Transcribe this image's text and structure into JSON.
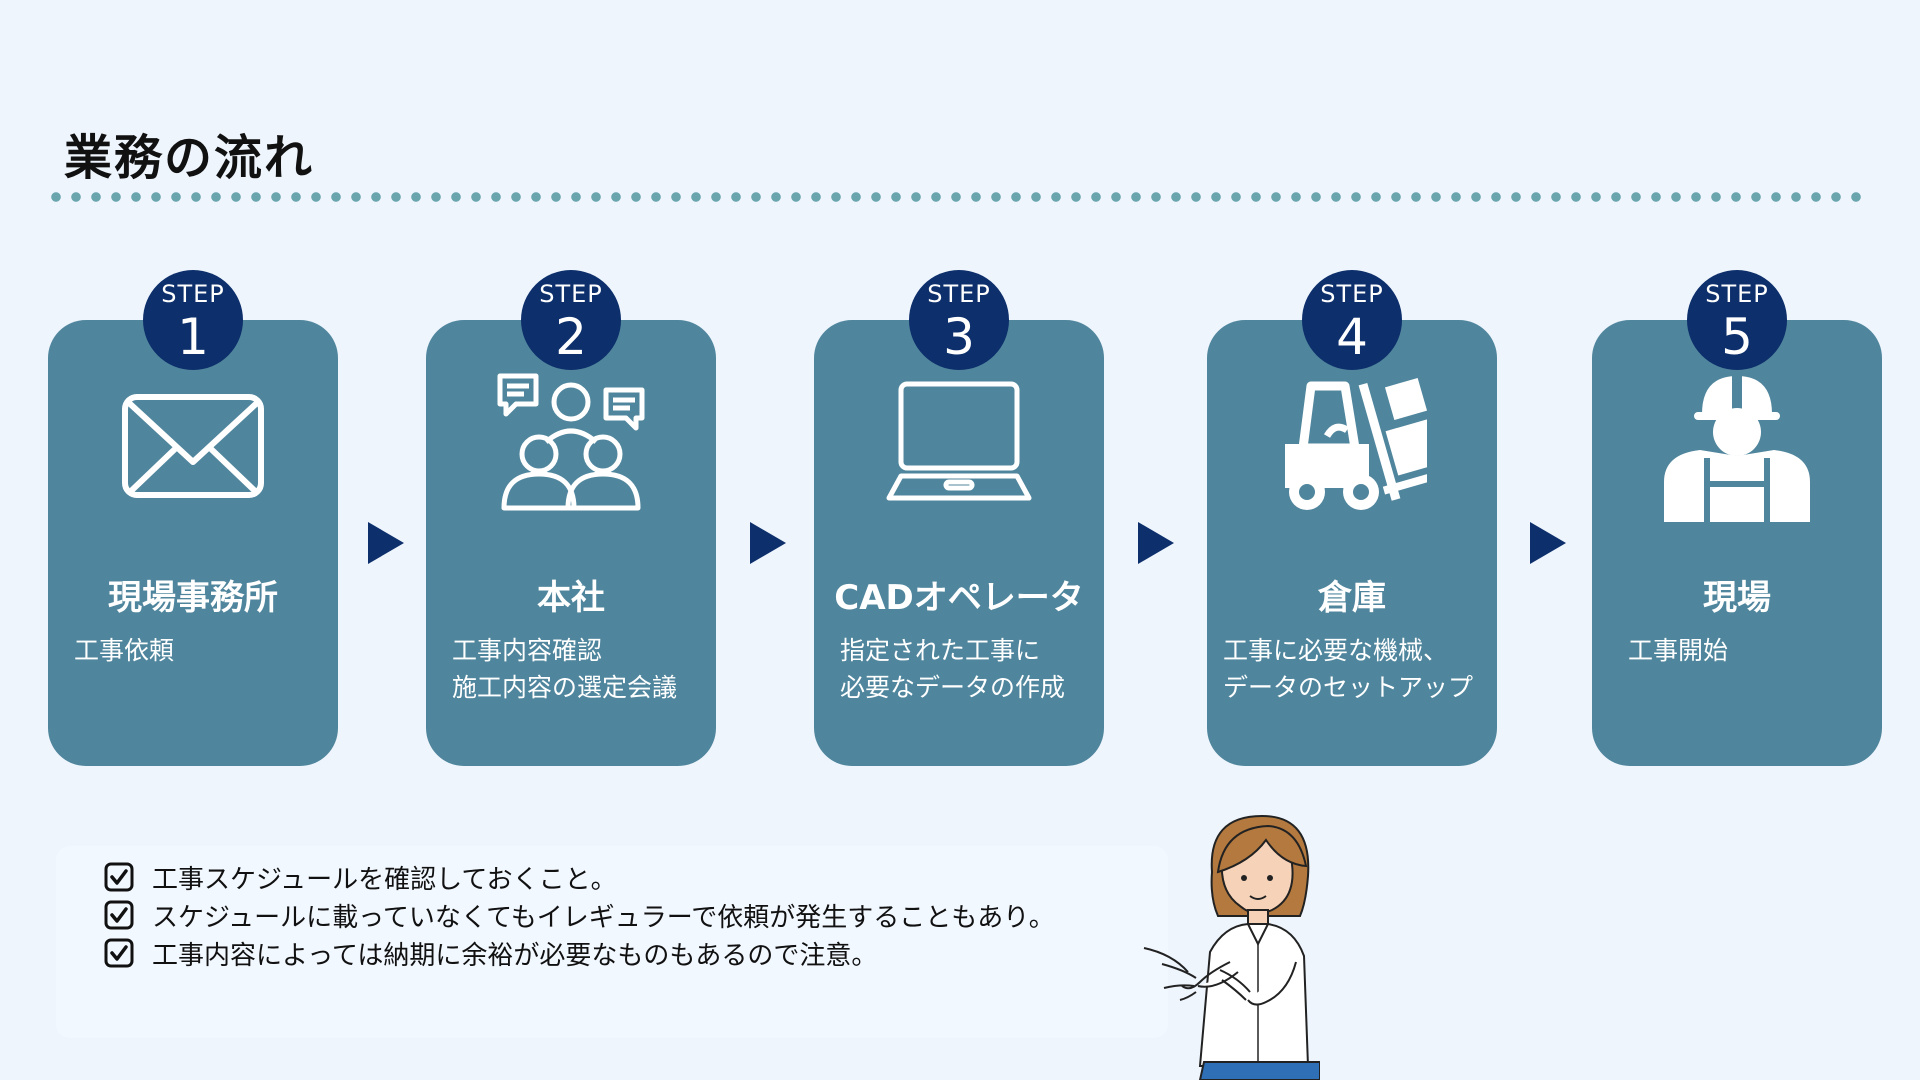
{
  "title": "業務の流れ",
  "steps": [
    {
      "badge": "STEP",
      "number": "1",
      "icon": "envelope-icon",
      "title": "現場事務所",
      "desc": [
        "工事依頼"
      ]
    },
    {
      "badge": "STEP",
      "number": "2",
      "icon": "meeting-icon",
      "title": "本社",
      "desc": [
        "工事内容確認",
        "施工内容の選定会議"
      ]
    },
    {
      "badge": "STEP",
      "number": "3",
      "icon": "laptop-icon",
      "title": "CADオペレータ",
      "desc": [
        "指定された工事に",
        "必要なデータの作成"
      ]
    },
    {
      "badge": "STEP",
      "number": "4",
      "icon": "forklift-icon",
      "title": "倉庫",
      "desc": [
        "工事に必要な機械、",
        "データのセットアップ"
      ]
    },
    {
      "badge": "STEP",
      "number": "5",
      "icon": "worker-icon",
      "title": "現場",
      "desc": [
        "工事開始"
      ]
    }
  ],
  "notes": [
    "工事スケジュールを確認しておくこと。",
    "スケジュールに載っていなくてもイレギュラーで依頼が発生することもあり。",
    "工事内容によっては納期に余裕が必要なものもあるので注意。"
  ],
  "colors": {
    "background": "#eef5fd",
    "card": "#50869d",
    "badge": "#0d2f6b",
    "dots": "#6aa5ad"
  }
}
